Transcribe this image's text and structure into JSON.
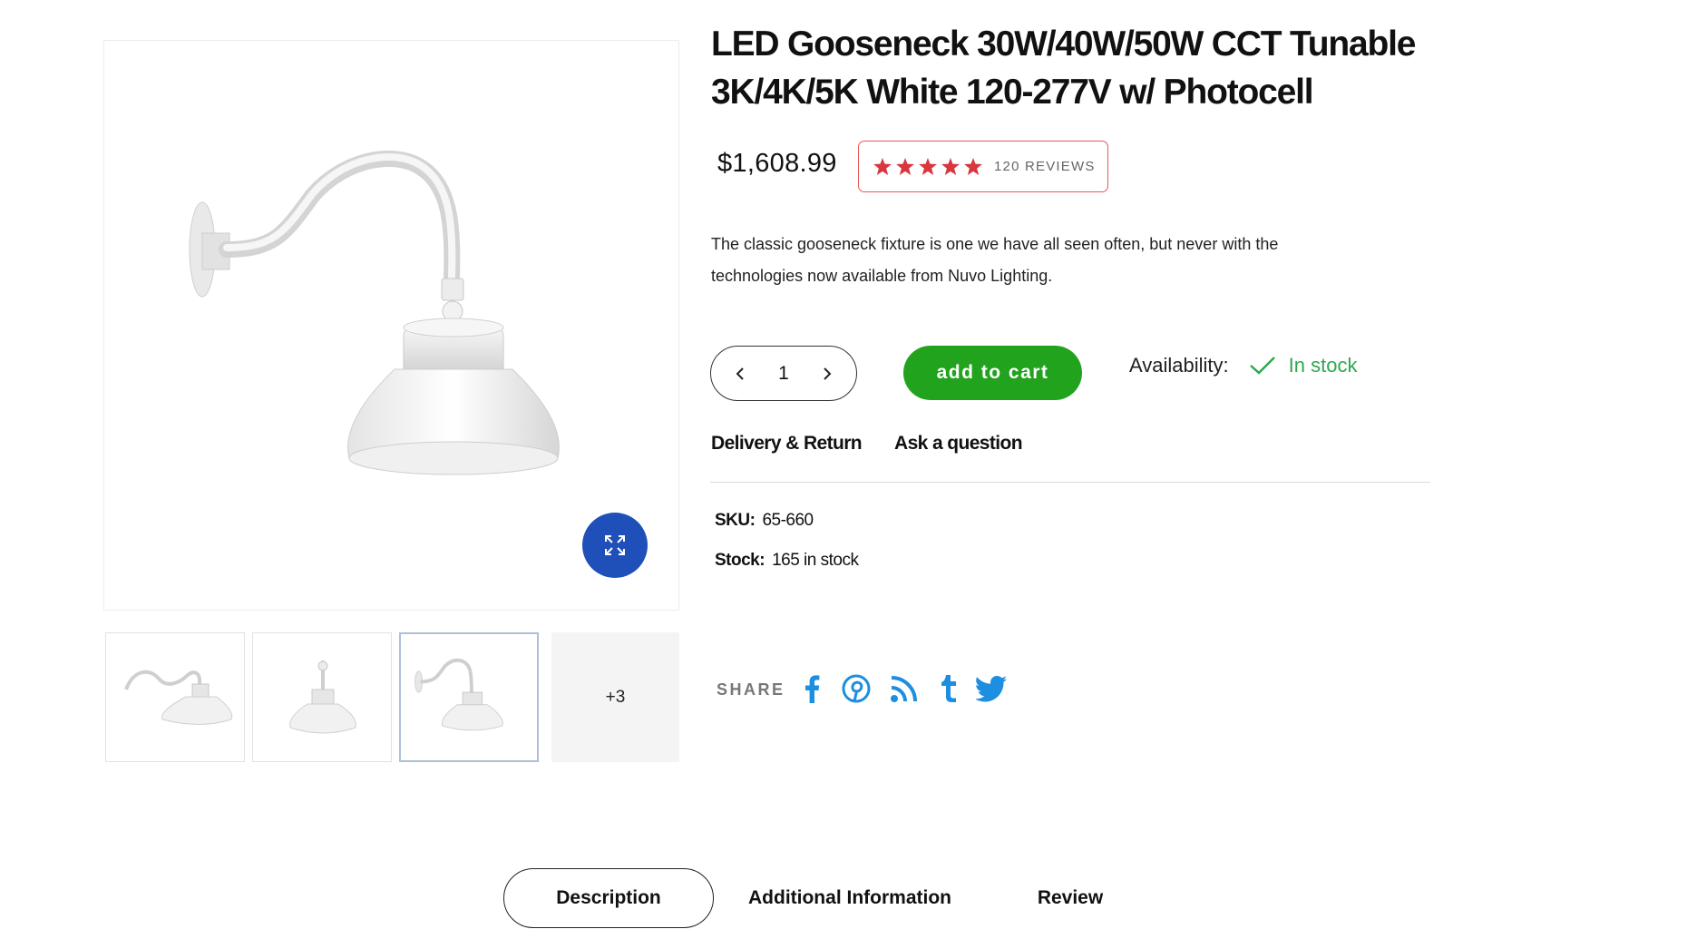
{
  "product": {
    "title_line1": "LED Gooseneck 30W/40W/50W CCT Tunable",
    "title_line2": "3K/4K/5K White 120-277V w/ Photocell",
    "price": "$1,608.99",
    "rating_stars": 5,
    "reviews_label": "120 REVIEWS",
    "description": "The classic gooseneck fixture is one we have all seen often, but never with the technologies now available from Nuvo Lighting.",
    "quantity": "1",
    "add_to_cart_label": "add to cart",
    "availability_label": "Availability:",
    "availability_status": "In stock",
    "sku_label": "SKU:",
    "sku_value": "65-660",
    "stock_label": "Stock:",
    "stock_value": "165 in stock"
  },
  "links": {
    "delivery": "Delivery & Return",
    "ask": "Ask a question"
  },
  "gallery": {
    "more_label": "+3"
  },
  "share": {
    "label": "SHARE",
    "icons": [
      "facebook-icon",
      "pinterest-icon",
      "rss-icon",
      "tumblr-icon",
      "twitter-icon"
    ]
  },
  "tabs": [
    {
      "label": "Description",
      "active": true
    },
    {
      "label": "Additional Information",
      "active": false
    },
    {
      "label": "Review",
      "active": false
    }
  ],
  "colors": {
    "accent_blue": "#1f4fb8",
    "cart_green": "#22a31e",
    "instock_green": "#2fa84f",
    "star_red": "#d9363e",
    "share_blue": "#1d8fe0"
  }
}
